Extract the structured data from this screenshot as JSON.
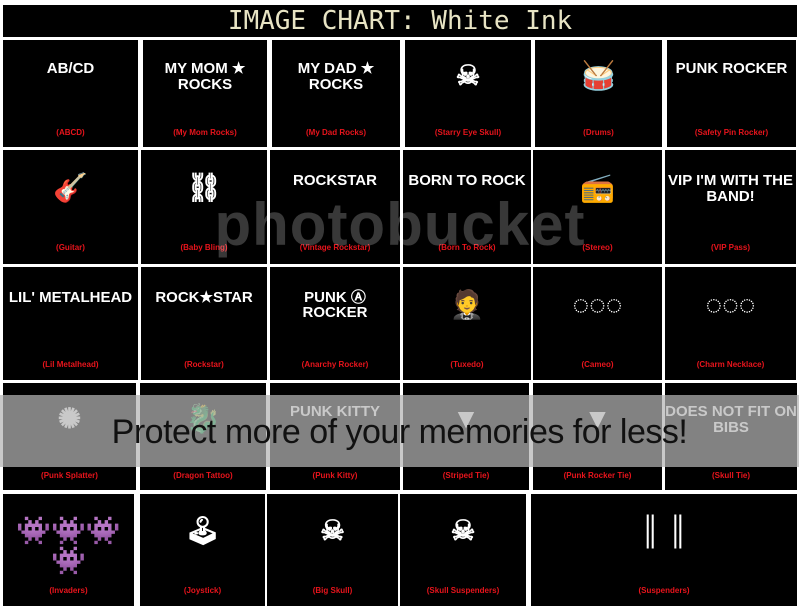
{
  "title": "IMAGE CHART: White Ink",
  "watermark": {
    "brand": "photobucket",
    "slogan": "Protect more of your memories for less!"
  },
  "colors": {
    "label": "#e8141c",
    "title": "#e8e4c4",
    "background": "#000000"
  },
  "designs": [
    {
      "label": "(ABCD)",
      "art": "AB/CD"
    },
    {
      "label": "(My Mom Rocks)",
      "art": "MY MOM ★ ROCKS"
    },
    {
      "label": "(My Dad Rocks)",
      "art": "MY DAD ★ ROCKS"
    },
    {
      "label": "(Starry Eye Skull)",
      "art": "☠"
    },
    {
      "label": "(Drums)",
      "art": "drum-kit"
    },
    {
      "label": "(Safety Pin Rocker)",
      "art": "PUNK ROCKER"
    },
    {
      "label": "(Guitar)",
      "art": "guitar"
    },
    {
      "label": "(Baby Bling)",
      "art": "chain"
    },
    {
      "label": "(Vintage Rockstar)",
      "art": "ROCKSTAR"
    },
    {
      "label": "(Born To Rock)",
      "art": "BORN TO ROCK"
    },
    {
      "label": "(Stereo)",
      "art": "boombox"
    },
    {
      "label": "(VIP Pass)",
      "art": "VIP I'M WITH THE BAND!"
    },
    {
      "label": "(Lil Metalhead)",
      "art": "LIL' METALHEAD"
    },
    {
      "label": "(Rockstar)",
      "art": "ROCK★STAR"
    },
    {
      "label": "(Anarchy Rocker)",
      "art": "PUNK Ⓐ ROCKER"
    },
    {
      "label": "(Tuxedo)",
      "art": "tuxedo"
    },
    {
      "label": "(Cameo)",
      "art": "necklace"
    },
    {
      "label": "(Charm Necklace)",
      "art": "necklace"
    },
    {
      "label": "(Punk Splatter)",
      "art": "splatter"
    },
    {
      "label": "(Dragon Tattoo)",
      "art": "dragon"
    },
    {
      "label": "(Punk Kitty)",
      "art": "PUNK KITTY"
    },
    {
      "label": "(Striped Tie)",
      "art": "tie"
    },
    {
      "label": "(Punk Rocker Tie)",
      "art": "tie"
    },
    {
      "label": "(Skull Tie)",
      "art": "DOES NOT FIT ON BIBS"
    },
    {
      "label": "(Invaders)",
      "art": "invaders"
    },
    {
      "label": "(Joystick)",
      "art": "joystick"
    },
    {
      "label": "(Big Skull)",
      "art": "☠"
    },
    {
      "label": "(Skull Suspenders)",
      "art": "☠"
    },
    {
      "label": "(Suspenders)",
      "art": "suspenders"
    }
  ]
}
